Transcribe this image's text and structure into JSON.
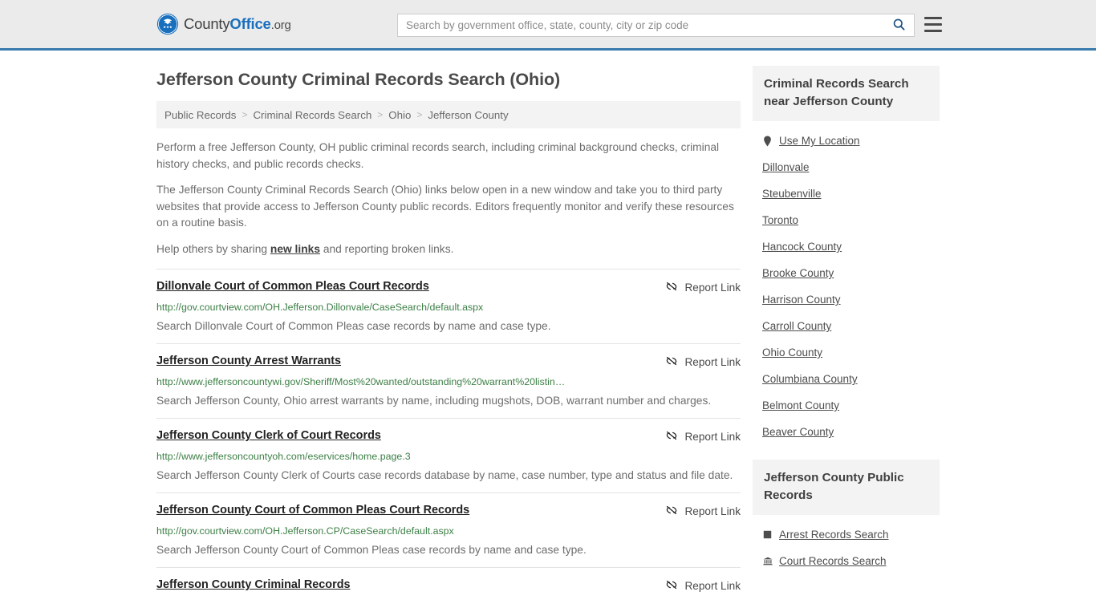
{
  "header": {
    "brand": {
      "part1": "County",
      "part2": "Office",
      "part3": ".org",
      "icon": "eagle-seal-logo"
    },
    "search": {
      "placeholder": "Search by government office, state, county, city or zip code",
      "value": "",
      "icon": "search-icon"
    },
    "menu_icon": "hamburger-menu-icon",
    "accent_color": "#3a7cae",
    "background": "#ebebeb"
  },
  "main": {
    "title": "Jefferson County Criminal Records Search (Ohio)",
    "breadcrumb": {
      "separator": ">",
      "items": [
        {
          "label": "Public Records"
        },
        {
          "label": "Criminal Records Search"
        },
        {
          "label": "Ohio"
        },
        {
          "label": "Jefferson County"
        }
      ]
    },
    "intro": {
      "p1": "Perform a free Jefferson County, OH public criminal records search, including criminal background checks, criminal history checks, and public records checks.",
      "p2": "The Jefferson County Criminal Records Search (Ohio) links below open in a new window and take you to third party websites that provide access to Jefferson County public records. Editors frequently monitor and verify these resources on a routine basis.",
      "p3_before": "Help others by sharing ",
      "p3_link": "new links",
      "p3_after": " and reporting broken links."
    },
    "report_link_label": "Report Link",
    "report_link_icon": "broken-link-icon",
    "results": [
      {
        "title": "Dillonvale Court of Common Pleas Court Records",
        "url": "http://gov.courtview.com/OH.Jefferson.Dillonvale/CaseSearch/default.aspx",
        "description": "Search Dillonvale Court of Common Pleas case records by name and case type."
      },
      {
        "title": "Jefferson County Arrest Warrants",
        "url": "http://www.jeffersoncountywi.gov/Sheriff/Most%20wanted/outstanding%20warrant%20listin…",
        "description": "Search Jefferson County, Ohio arrest warrants by name, including mugshots, DOB, warrant number and charges."
      },
      {
        "title": "Jefferson County Clerk of Court Records",
        "url": "http://www.jeffersoncountyoh.com/eservices/home.page.3",
        "description": "Search Jefferson County Clerk of Courts case records database by name, case number, type and status and file date."
      },
      {
        "title": "Jefferson County Court of Common Pleas Court Records",
        "url": "http://gov.courtview.com/OH.Jefferson.CP/CaseSearch/default.aspx",
        "description": "Search Jefferson County Court of Common Pleas case records by name and case type."
      },
      {
        "title": "Jefferson County Criminal Records",
        "url": "",
        "description": ""
      }
    ]
  },
  "sidebar": {
    "nearby": {
      "title": "Criminal Records Search near Jefferson County",
      "items": [
        {
          "label": "Use My Location",
          "icon": "map-pin-icon"
        },
        {
          "label": "Dillonvale",
          "icon": ""
        },
        {
          "label": "Steubenville",
          "icon": ""
        },
        {
          "label": "Toronto",
          "icon": ""
        },
        {
          "label": "Hancock County",
          "icon": ""
        },
        {
          "label": "Brooke County",
          "icon": ""
        },
        {
          "label": "Harrison County",
          "icon": ""
        },
        {
          "label": "Carroll County",
          "icon": ""
        },
        {
          "label": "Ohio County",
          "icon": ""
        },
        {
          "label": "Columbiana County",
          "icon": ""
        },
        {
          "label": "Belmont County",
          "icon": ""
        },
        {
          "label": "Beaver County",
          "icon": ""
        }
      ]
    },
    "public_records": {
      "title": "Jefferson County Public Records",
      "items": [
        {
          "label": "Arrest Records Search",
          "icon": "square-badge-icon"
        },
        {
          "label": "Court Records Search",
          "icon": "courthouse-icon"
        }
      ]
    }
  }
}
